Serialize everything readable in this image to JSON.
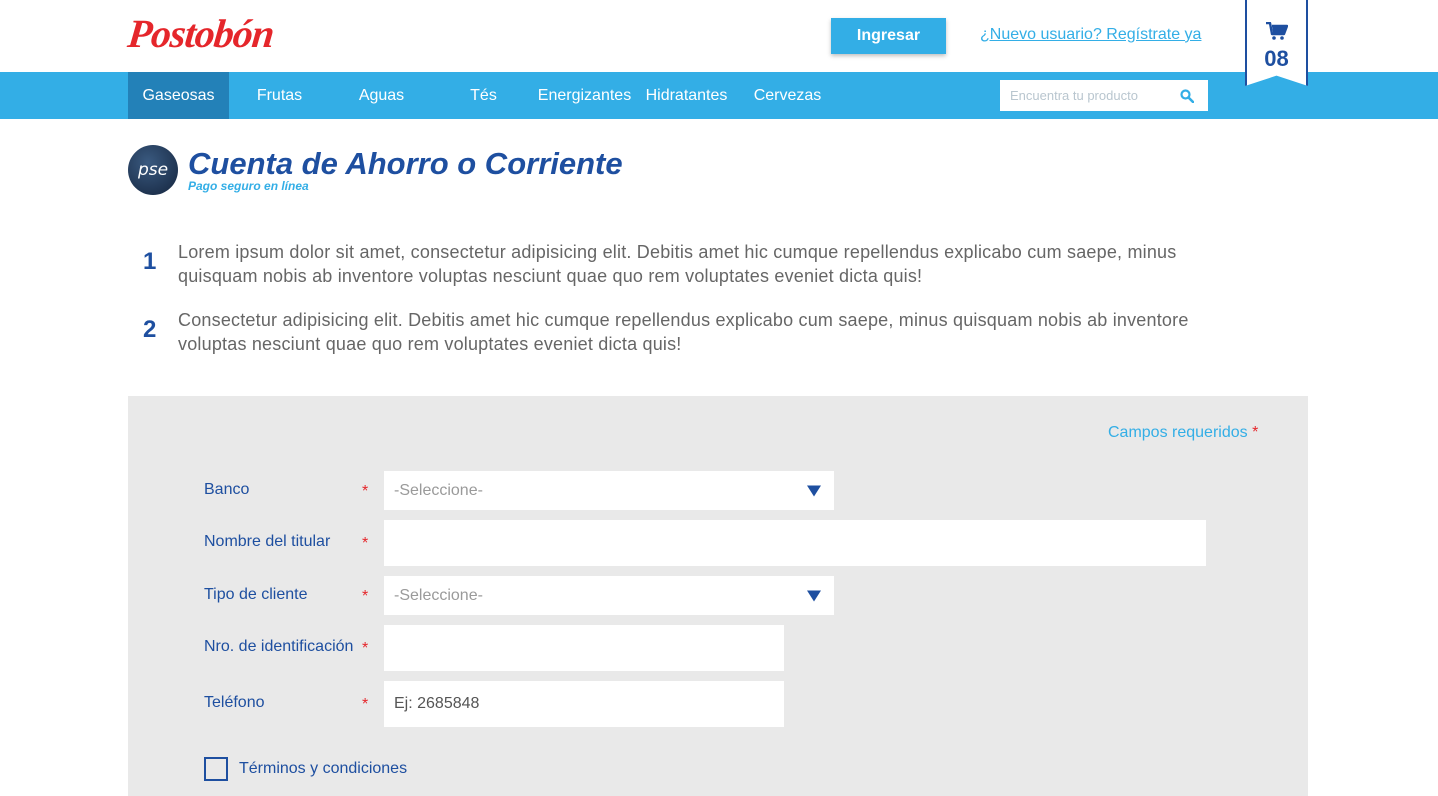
{
  "header": {
    "logo_text": "Postobón",
    "login_label": "Ingresar",
    "register_label": "¿Nuevo usuario? Regístrate ya",
    "cart_count": "08"
  },
  "nav": {
    "items": [
      "Gaseosas",
      "Frutas",
      "Aguas",
      "Tés",
      "Energizantes",
      "Hidratantes",
      "Cervezas"
    ],
    "active_index": 0,
    "search_placeholder": "Encuentra tu producto"
  },
  "title": {
    "logo_text": "pse",
    "heading": "Cuenta de Ahorro o Corriente",
    "subheading": "Pago seguro en línea"
  },
  "steps": [
    {
      "number": "1",
      "text": "Lorem ipsum dolor sit amet, consectetur adipisicing elit. Debitis amet hic cumque repellendus explicabo cum saepe, minus quisquam nobis ab inventore voluptas nesciunt quae quo rem voluptates eveniet dicta quis!"
    },
    {
      "number": "2",
      "text": "Consectetur adipisicing elit. Debitis amet hic cumque repellendus explicabo cum saepe, minus quisquam nobis ab inventore voluptas nesciunt quae quo rem voluptates eveniet dicta quis!"
    }
  ],
  "form": {
    "required_note": "Campos requeridos",
    "required_star": "*",
    "fields": [
      {
        "label": "Banco",
        "value": "-Seleccione-"
      },
      {
        "label": "Nombre del titular",
        "value": ""
      },
      {
        "label": "Tipo de cliente",
        "value": "-Seleccione-"
      },
      {
        "label": "Nro. de identificación",
        "value": ""
      },
      {
        "label": "Teléfono",
        "value": "Ej: 2685848"
      }
    ],
    "terms_label": "Términos y condiciones"
  },
  "colors": {
    "brand_red": "#e5262b",
    "primary_blue": "#33aee6",
    "dark_blue": "#1e4fa0",
    "nav_active": "#2381b8",
    "panel_gray": "#e9e9e9"
  }
}
